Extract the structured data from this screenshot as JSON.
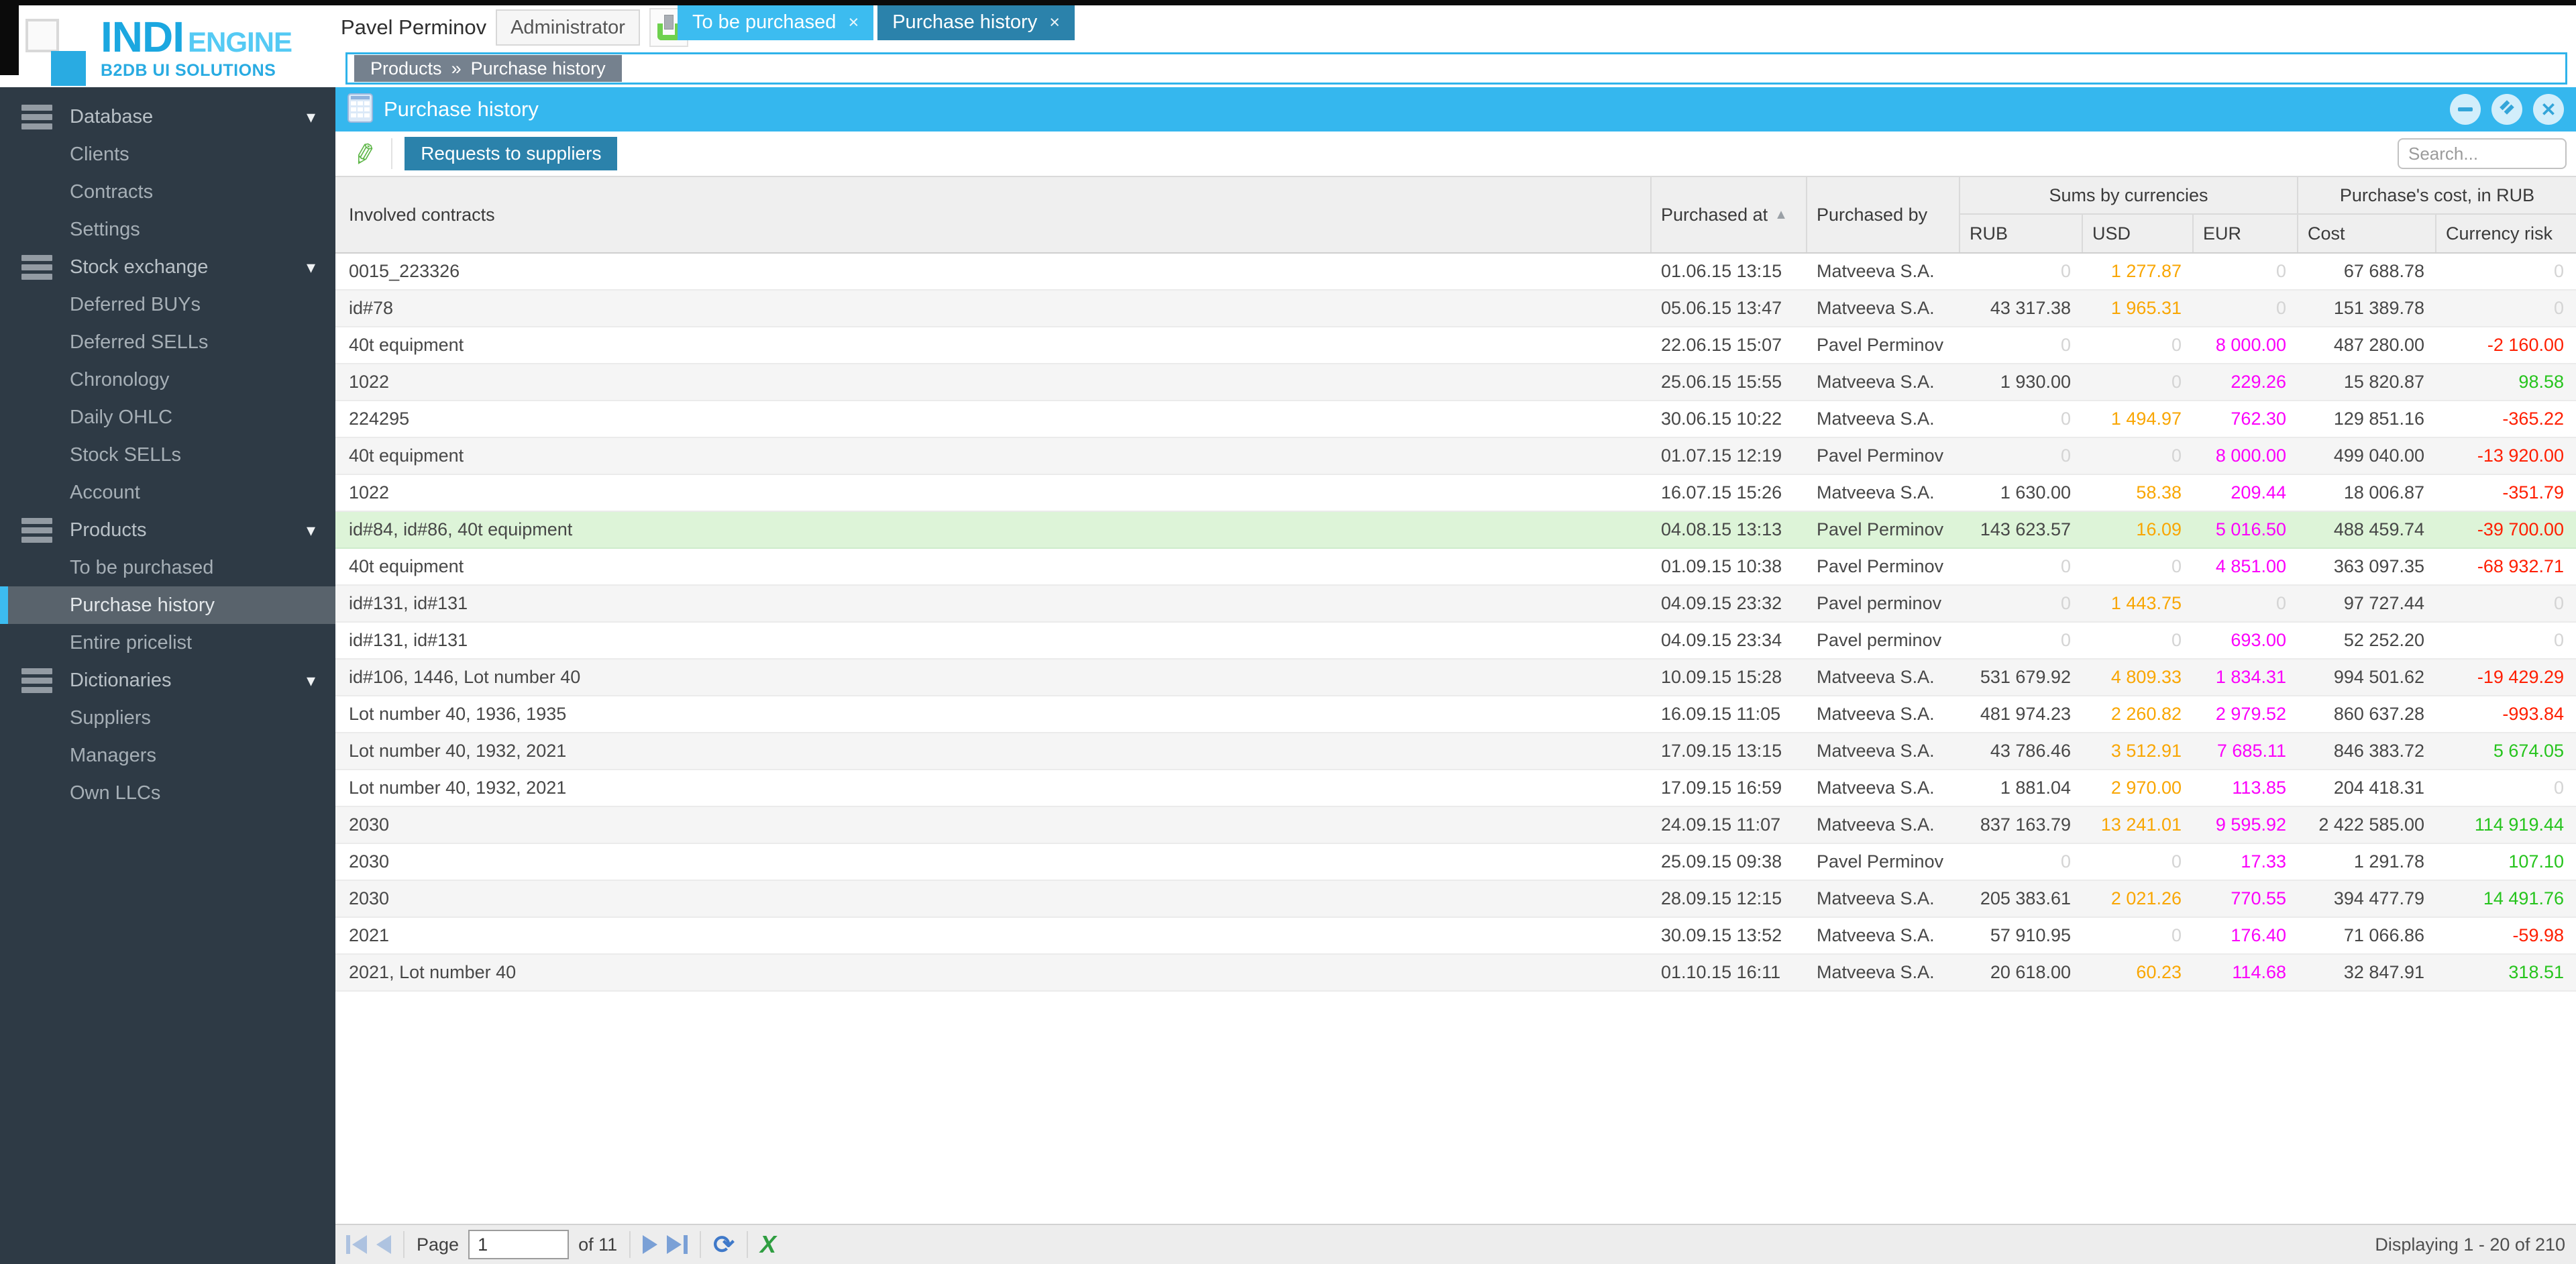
{
  "logo": {
    "name_bold": "INDI",
    "name_light": "ENGINE",
    "subtitle": "B2DB UI SOLUTIONS"
  },
  "header": {
    "user_name": "Pavel Perminov",
    "role": "Administrator"
  },
  "tabs": [
    {
      "label": "To be purchased",
      "active": true
    },
    {
      "label": "Purchase history",
      "active": false
    }
  ],
  "breadcrumb": {
    "section": "Products",
    "separator": "»",
    "page": "Purchase history"
  },
  "sidebar": {
    "items": [
      {
        "type": "group",
        "label": "Database"
      },
      {
        "type": "item",
        "label": "Clients"
      },
      {
        "type": "item",
        "label": "Contracts"
      },
      {
        "type": "item",
        "label": "Settings"
      },
      {
        "type": "group",
        "label": "Stock exchange"
      },
      {
        "type": "item",
        "label": "Deferred BUYs"
      },
      {
        "type": "item",
        "label": "Deferred SELLs"
      },
      {
        "type": "item",
        "label": "Chronology"
      },
      {
        "type": "item",
        "label": "Daily OHLC"
      },
      {
        "type": "item",
        "label": "Stock SELLs"
      },
      {
        "type": "item",
        "label": "Account"
      },
      {
        "type": "group",
        "label": "Products"
      },
      {
        "type": "item",
        "label": "To be purchased"
      },
      {
        "type": "item",
        "label": "Purchase history",
        "selected": true
      },
      {
        "type": "item",
        "label": "Entire pricelist"
      },
      {
        "type": "group",
        "label": "Dictionaries"
      },
      {
        "type": "item",
        "label": "Suppliers"
      },
      {
        "type": "item",
        "label": "Managers"
      },
      {
        "type": "item",
        "label": "Own LLCs"
      }
    ]
  },
  "panel": {
    "title": "Purchase history"
  },
  "toolbar": {
    "requests_button": "Requests to suppliers",
    "search_placeholder": "Search..."
  },
  "table": {
    "headers": {
      "contracts": "Involved contracts",
      "purchased_at": "Purchased at",
      "purchased_by": "Purchased by",
      "sums_group": "Sums by currencies",
      "cost_group": "Purchase's cost, in RUB",
      "rub": "RUB",
      "usd": "USD",
      "eur": "EUR",
      "cost": "Cost",
      "risk": "Currency risk"
    },
    "rows": [
      {
        "contracts": "0015_223326",
        "purchased_at": "01.06.15 13:15",
        "purchased_by": "Matveeva S.A.",
        "rub": "0",
        "usd": "1 277.87",
        "eur": "0",
        "cost": "67 688.78",
        "risk": "0"
      },
      {
        "contracts": "id#78",
        "purchased_at": "05.06.15 13:47",
        "purchased_by": "Matveeva S.A.",
        "rub": "43 317.38",
        "usd": "1 965.31",
        "eur": "0",
        "cost": "151 389.78",
        "risk": "0"
      },
      {
        "contracts": "40t equipment",
        "purchased_at": "22.06.15 15:07",
        "purchased_by": "Pavel Perminov",
        "rub": "0",
        "usd": "0",
        "eur": "8 000.00",
        "cost": "487 280.00",
        "risk": "-2 160.00"
      },
      {
        "contracts": "1022",
        "purchased_at": "25.06.15 15:55",
        "purchased_by": "Matveeva S.A.",
        "rub": "1 930.00",
        "usd": "0",
        "eur": "229.26",
        "cost": "15 820.87",
        "risk": "98.58"
      },
      {
        "contracts": "224295",
        "purchased_at": "30.06.15 10:22",
        "purchased_by": "Matveeva S.A.",
        "rub": "0",
        "usd": "1 494.97",
        "eur": "762.30",
        "cost": "129 851.16",
        "risk": "-365.22"
      },
      {
        "contracts": "40t equipment",
        "purchased_at": "01.07.15 12:19",
        "purchased_by": "Pavel Perminov",
        "rub": "0",
        "usd": "0",
        "eur": "8 000.00",
        "cost": "499 040.00",
        "risk": "-13 920.00"
      },
      {
        "contracts": "1022",
        "purchased_at": "16.07.15 15:26",
        "purchased_by": "Matveeva S.A.",
        "rub": "1 630.00",
        "usd": "58.38",
        "eur": "209.44",
        "cost": "18 006.87",
        "risk": "-351.79"
      },
      {
        "contracts": "id#84, id#86, 40t equipment",
        "purchased_at": "04.08.15 13:13",
        "purchased_by": "Pavel Perminov",
        "rub": "143 623.57",
        "usd": "16.09",
        "eur": "5 016.50",
        "cost": "488 459.74",
        "risk": "-39 700.00",
        "highlight": true
      },
      {
        "contracts": "40t equipment",
        "purchased_at": "01.09.15 10:38",
        "purchased_by": "Pavel Perminov",
        "rub": "0",
        "usd": "0",
        "eur": "4 851.00",
        "cost": "363 097.35",
        "risk": "-68 932.71"
      },
      {
        "contracts": "id#131, id#131",
        "purchased_at": "04.09.15 23:32",
        "purchased_by": "Pavel perminov",
        "rub": "0",
        "usd": "1 443.75",
        "eur": "0",
        "cost": "97 727.44",
        "risk": "0"
      },
      {
        "contracts": "id#131, id#131",
        "purchased_at": "04.09.15 23:34",
        "purchased_by": "Pavel perminov",
        "rub": "0",
        "usd": "0",
        "eur": "693.00",
        "cost": "52 252.20",
        "risk": "0"
      },
      {
        "contracts": "id#106, 1446, Lot number 40",
        "purchased_at": "10.09.15 15:28",
        "purchased_by": "Matveeva S.A.",
        "rub": "531 679.92",
        "usd": "4 809.33",
        "eur": "1 834.31",
        "cost": "994 501.62",
        "risk": "-19 429.29"
      },
      {
        "contracts": "Lot number 40, 1936, 1935",
        "purchased_at": "16.09.15 11:05",
        "purchased_by": "Matveeva S.A.",
        "rub": "481 974.23",
        "usd": "2 260.82",
        "eur": "2 979.52",
        "cost": "860 637.28",
        "risk": "-993.84"
      },
      {
        "contracts": "Lot number 40, 1932, 2021",
        "purchased_at": "17.09.15 13:15",
        "purchased_by": "Matveeva S.A.",
        "rub": "43 786.46",
        "usd": "3 512.91",
        "eur": "7 685.11",
        "cost": "846 383.72",
        "risk": "5 674.05"
      },
      {
        "contracts": "Lot number 40, 1932, 2021",
        "purchased_at": "17.09.15 16:59",
        "purchased_by": "Matveeva S.A.",
        "rub": "1 881.04",
        "usd": "2 970.00",
        "eur": "113.85",
        "cost": "204 418.31",
        "risk": "0"
      },
      {
        "contracts": "2030",
        "purchased_at": "24.09.15 11:07",
        "purchased_by": "Matveeva S.A.",
        "rub": "837 163.79",
        "usd": "13 241.01",
        "eur": "9 595.92",
        "cost": "2 422 585.00",
        "risk": "114 919.44"
      },
      {
        "contracts": "2030",
        "purchased_at": "25.09.15 09:38",
        "purchased_by": "Pavel Perminov",
        "rub": "0",
        "usd": "0",
        "eur": "17.33",
        "cost": "1 291.78",
        "risk": "107.10"
      },
      {
        "contracts": "2030",
        "purchased_at": "28.09.15 12:15",
        "purchased_by": "Matveeva S.A.",
        "rub": "205 383.61",
        "usd": "2 021.26",
        "eur": "770.55",
        "cost": "394 477.79",
        "risk": "14 491.76"
      },
      {
        "contracts": "2021",
        "purchased_at": "30.09.15 13:52",
        "purchased_by": "Matveeva S.A.",
        "rub": "57 910.95",
        "usd": "0",
        "eur": "176.40",
        "cost": "71 066.86",
        "risk": "-59.98"
      },
      {
        "contracts": "2021, Lot number 40",
        "purchased_at": "01.10.15 16:11",
        "purchased_by": "Matveeva S.A.",
        "rub": "20 618.00",
        "usd": "60.23",
        "eur": "114.68",
        "cost": "32 847.91",
        "risk": "318.51"
      }
    ]
  },
  "pagination": {
    "page_label": "Page",
    "page_value": "1",
    "of_label": "of 11",
    "displaying": "Displaying 1 - 20 of 210"
  },
  "icons": {
    "tab_close": "×",
    "minimize": "−",
    "close": "✕",
    "pencil": "✎",
    "refresh": "⟳",
    "excel": "X",
    "sort_asc": "▲",
    "chevron_down": "▾"
  },
  "colors": {
    "accent": "#35b7ee",
    "tab_inactive": "#2b82ab",
    "sidebar_bg": "#2e3a45",
    "usd": "#f9a602",
    "eur": "#fb00fb",
    "risk_negative": "#ff1e00",
    "risk_positive": "#26c41d",
    "row_highlight": "#ddf4d8"
  }
}
